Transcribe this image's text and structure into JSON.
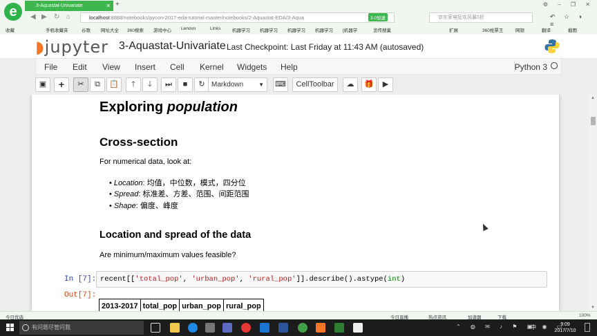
{
  "browser": {
    "tab_title": "3-Aquastat-Univariate",
    "url_host": "localhost",
    "url_rest": ":8888/notebooks/pycon-2017-eda-tutorial-master/notebooks/2-Aquastat-EDA/3-Aqua",
    "speed_badge": "3.0加速",
    "search_placeholder": "京东家电狂欢风暴5折",
    "bookmarks": [
      "收藏",
      "手机收藏夹",
      "谷歌",
      "网址大全",
      "360搜索",
      "游戏中心",
      "Lenovo",
      "Links",
      "机器学习",
      "机器学习",
      "机器学习",
      "机器学习",
      "[机器学",
      "览传搜巢"
    ],
    "bookmarks_right": [
      "扩展",
      "360抢票王",
      "网银",
      "翻译",
      "截图"
    ]
  },
  "jupyter": {
    "logo_text": "jupyter",
    "notebook_title": "3-Aquastat-Univariate",
    "checkpoint": "Last Checkpoint: Last Friday at 11:43 AM (autosaved)",
    "menu": [
      "File",
      "Edit",
      "View",
      "Insert",
      "Cell",
      "Kernel",
      "Widgets",
      "Help"
    ],
    "kernel": "Python 3",
    "cell_type": "Markdown",
    "celltoolbar_label": "CellToolbar"
  },
  "notebook": {
    "h1_prefix": "Exploring ",
    "h1_emph": "population",
    "h2_cross": "Cross-section",
    "intro_text": "For numerical data, look at:",
    "bullets": [
      {
        "term": "Location",
        "rest": ": 均值，中位数，模式，四分位"
      },
      {
        "term": "Spread",
        "rest": ": 标准差、方差、范围、间距范围"
      },
      {
        "term": "Shape",
        "rest": ": 偏度、峰度"
      }
    ],
    "h2_location": "Location and spread of the data",
    "question": "Are minimum/maximum values feasible?",
    "in_prompt": "In [7]:",
    "out_prompt": "Out[7]:",
    "code": {
      "p1": "recent[[",
      "s1": "'total_pop'",
      "c1": ", ",
      "s2": "'urban_pop'",
      "c2": ", ",
      "s3": "'rural_pop'",
      "p2": "]].describe().astype(",
      "kw": "int",
      "p3": ")"
    },
    "table_headers": [
      "2013-2017",
      "total_pop",
      "urban_pop",
      "rural_pop"
    ]
  },
  "status_bar": {
    "left": "今日优选",
    "live": "今日直播",
    "hot": "热点资讯",
    "accelerator": "加速器",
    "download": "下载",
    "zoom": "100%"
  },
  "taskbar": {
    "search_placeholder": "有问题尽管问我",
    "time": "9:09",
    "date": "2017/7/10",
    "lang": "中"
  }
}
